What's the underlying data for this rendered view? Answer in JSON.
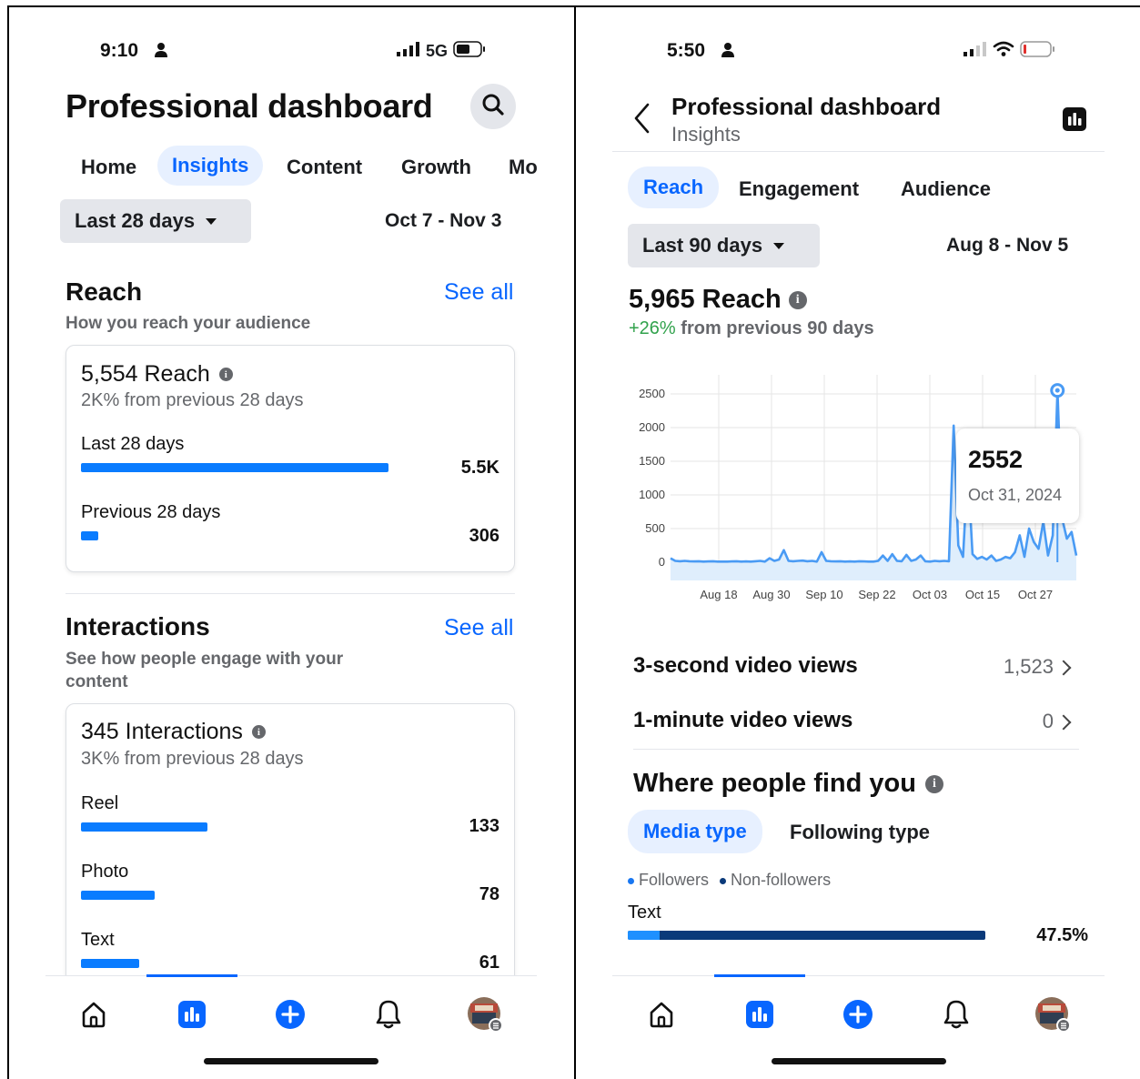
{
  "left": {
    "status": {
      "time": "9:10",
      "network": "5G"
    },
    "header": {
      "title": "Professional dashboard"
    },
    "tabs": [
      {
        "label": "Home",
        "active": false
      },
      {
        "label": "Insights",
        "active": true
      },
      {
        "label": "Content",
        "active": false
      },
      {
        "label": "Growth",
        "active": false
      },
      {
        "label": "Mo",
        "active": false
      }
    ],
    "filter": {
      "period": "Last 28 days",
      "date_range": "Oct 7 - Nov 3"
    },
    "reach": {
      "title": "Reach",
      "see_all": "See all",
      "subtitle": "How you reach your audience",
      "metric": "5,554 Reach",
      "change": "2K% from previous 28 days",
      "rows": [
        {
          "label": "Last 28 days",
          "value": "5.5K",
          "fraction": 1.0
        },
        {
          "label": "Previous 28 days",
          "value": "306",
          "fraction": 0.055
        }
      ]
    },
    "interactions": {
      "title": "Interactions",
      "see_all": "See all",
      "subtitle_line1": "See how people engage with your",
      "subtitle_line2": "content",
      "metric": "345 Interactions",
      "change": "3K% from previous 28 days",
      "rows": [
        {
          "label": "Reel",
          "value": "133",
          "fraction": 0.41
        },
        {
          "label": "Photo",
          "value": "78",
          "fraction": 0.24
        },
        {
          "label": "Text",
          "value": "61",
          "fraction": 0.19
        }
      ]
    }
  },
  "right": {
    "status": {
      "time": "5:50"
    },
    "header": {
      "title": "Professional dashboard",
      "subtitle": "Insights"
    },
    "tabs": [
      {
        "label": "Reach",
        "active": true
      },
      {
        "label": "Engagement",
        "active": false
      },
      {
        "label": "Audience",
        "active": false
      }
    ],
    "filter": {
      "period": "Last 90 days",
      "date_range": "Aug 8 - Nov 5"
    },
    "reach": {
      "metric": "5,965 Reach",
      "change_pct": "+26%",
      "change_text": "from previous 90 days"
    },
    "tooltip": {
      "value": "2552",
      "date": "Oct 31, 2024"
    },
    "views": [
      {
        "label": "3-second video views",
        "value": "1,523"
      },
      {
        "label": "1-minute video views",
        "value": "0"
      }
    ],
    "where": {
      "title": "Where people find you",
      "subtabs": [
        {
          "label": "Media type",
          "active": true
        },
        {
          "label": "Following type",
          "active": false
        }
      ],
      "legend": [
        {
          "label": "Followers",
          "color": "#1877f2"
        },
        {
          "label": "Non-followers",
          "color": "#0a3a7a"
        }
      ],
      "row": {
        "label": "Text",
        "value": "47.5%",
        "followers_fraction": 0.09
      }
    }
  },
  "chart_data": {
    "type": "area",
    "title": "",
    "xlabel": "",
    "ylabel": "",
    "ylim": [
      0,
      2700
    ],
    "yticks": [
      0,
      500,
      1000,
      1500,
      2000,
      2500
    ],
    "x_tick_labels": [
      "Aug 18",
      "Aug 30",
      "Sep 10",
      "Sep 22",
      "Oct 03",
      "Oct 15",
      "Oct 27"
    ],
    "x_start": "Aug 8",
    "x_end": "Nov 5",
    "grid": true,
    "series": [
      {
        "name": "",
        "color": "#4a9bf4",
        "values": [
          60,
          20,
          15,
          20,
          15,
          12,
          15,
          10,
          12,
          15,
          10,
          10,
          10,
          12,
          15,
          10,
          12,
          10,
          15,
          20,
          10,
          60,
          20,
          40,
          180,
          20,
          15,
          20,
          25,
          15,
          20,
          10,
          150,
          20,
          15,
          12,
          15,
          10,
          12,
          10,
          15,
          12,
          10,
          10,
          20,
          100,
          20,
          120,
          20,
          15,
          110,
          20,
          40,
          100,
          15,
          10,
          20,
          15,
          20,
          15,
          2030,
          250,
          80,
          1400,
          120,
          50,
          80,
          40,
          100,
          20,
          40,
          80,
          60,
          150,
          400,
          80,
          500,
          300,
          200,
          600,
          100,
          400,
          2552,
          650,
          350,
          450,
          100
        ]
      }
    ],
    "highlight": {
      "value": 2552,
      "label": "Oct 31, 2024"
    }
  }
}
